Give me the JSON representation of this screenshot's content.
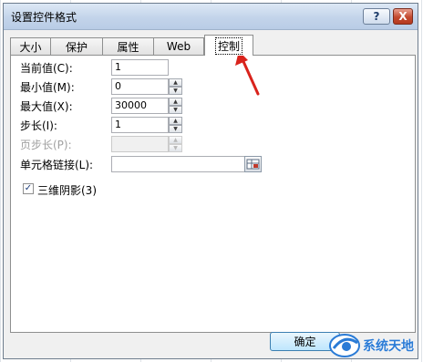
{
  "dialog": {
    "title": "设置控件格式",
    "help_label": "?",
    "close_label": "X"
  },
  "tabs": [
    {
      "label": "大小"
    },
    {
      "label": "保护"
    },
    {
      "label": "属性"
    },
    {
      "label": "Web"
    },
    {
      "label": "控制",
      "active": true
    }
  ],
  "fields": {
    "current_label": "当前值(C):",
    "current_value": "1",
    "min_label": "最小值(M):",
    "min_value": "0",
    "max_label": "最大值(X):",
    "max_value": "30000",
    "step_label": "步长(I):",
    "step_value": "1",
    "page_step_label": "页步长(P):",
    "page_step_value": "",
    "cell_link_label": "单元格链接(L):",
    "cell_link_value": ""
  },
  "checkbox": {
    "label": "三维阴影(3)",
    "checked": true,
    "mark": "✓"
  },
  "buttons": {
    "ok_label": "确定"
  },
  "watermark": {
    "text": "系统天地"
  },
  "colors": {
    "annotation_arrow": "#d9231c",
    "watermark": "#2a7bd6"
  }
}
